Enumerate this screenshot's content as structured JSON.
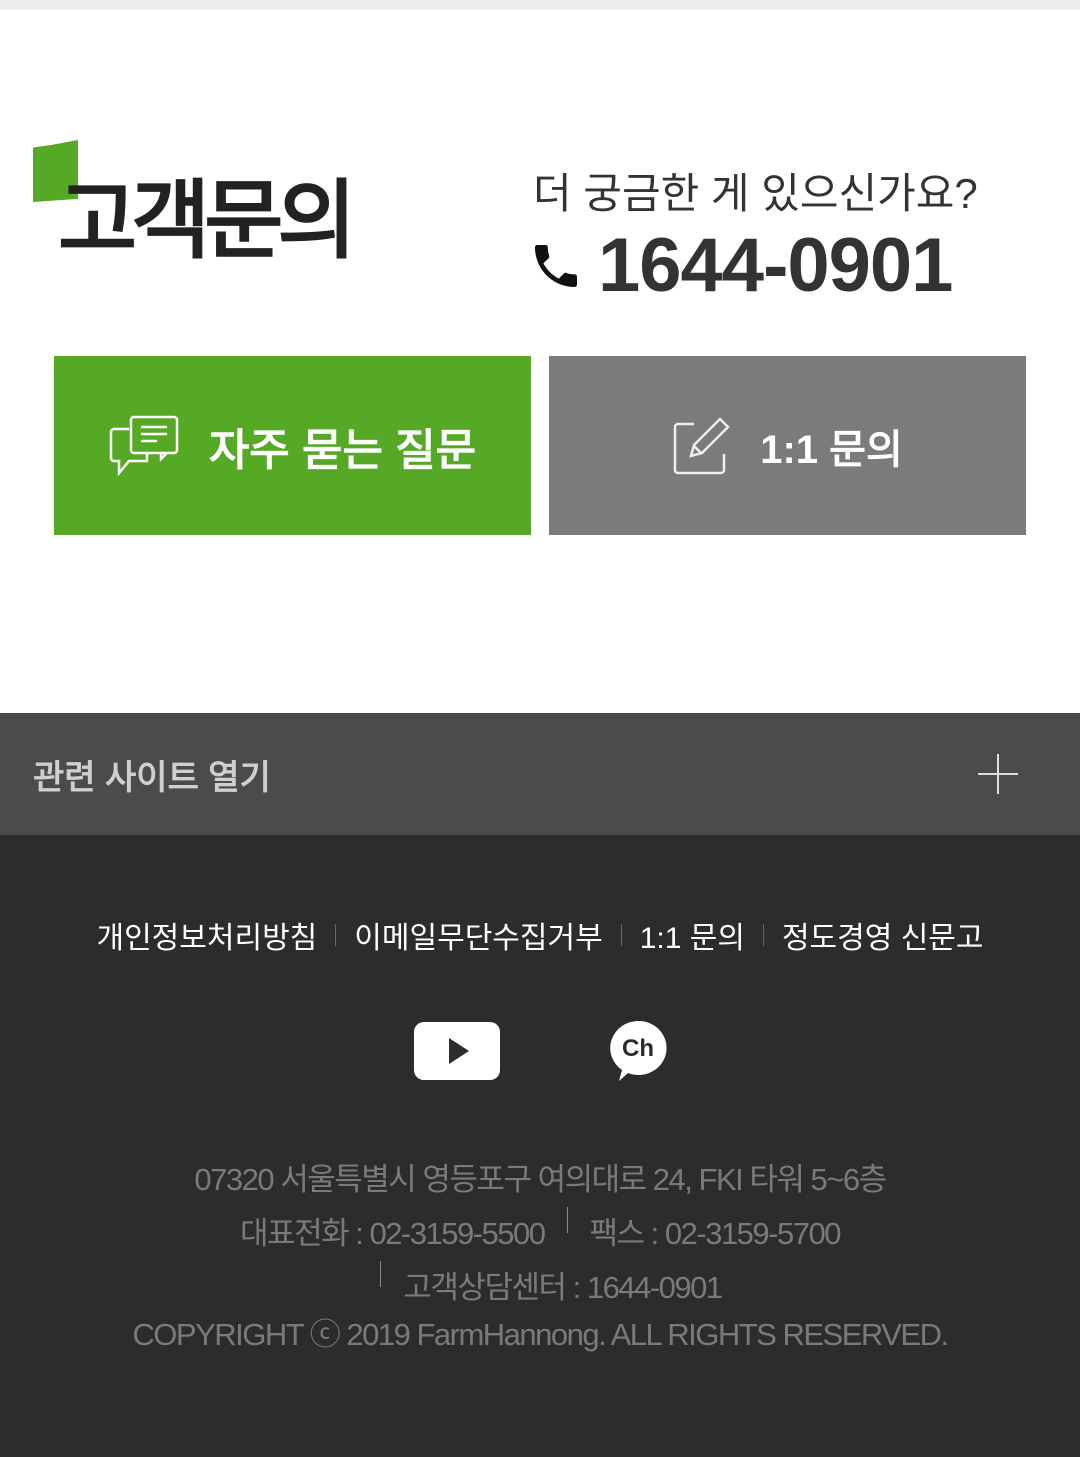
{
  "header": {
    "title": "고객문의",
    "question": "더 궁금한 게 있으신가요?",
    "phone": "1644-0901"
  },
  "buttons": {
    "faq": "자주 묻는 질문",
    "qna": "1:1 문의"
  },
  "related": {
    "label": "관련 사이트 열기"
  },
  "footer": {
    "links": [
      "개인정보처리방침",
      "이메일무단수집거부",
      "1:1 문의",
      "정도경영 신문고"
    ],
    "address": "07320 서울특별시 영등포구 여의대로 24, FKI 타워 5~6층",
    "tel": "대표전화 : 02-3159-5500",
    "fax": "팩스 : 02-3159-5700",
    "center": "고객상담센터 : 1644-0901",
    "copyright": "COPYRIGHT ⓒ 2019 FarmHannong. ALL RIGHTS RESERVED.",
    "social": {
      "youtube_icon": "play",
      "kakao_label": "Ch"
    }
  },
  "colors": {
    "green": "#55a924",
    "gray": "#7b7b7b",
    "footer": "#2b2c2e"
  }
}
